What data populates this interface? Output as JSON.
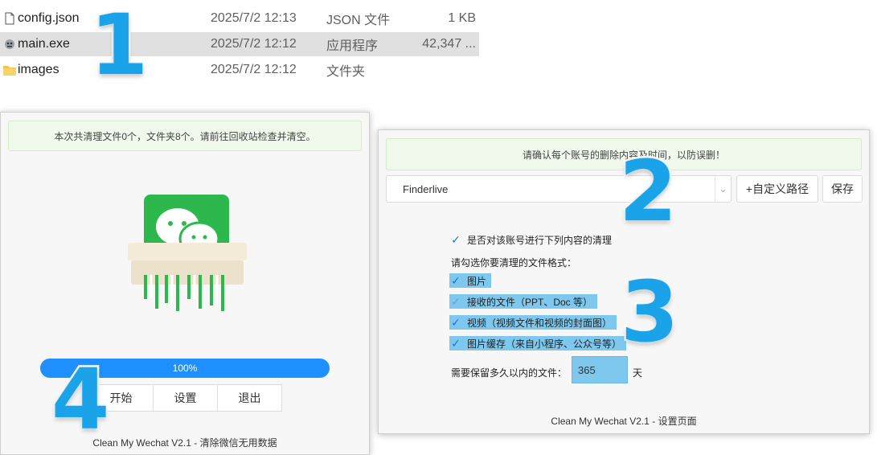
{
  "explorer": {
    "files": [
      {
        "icon": "json-file-icon",
        "name": "config.json",
        "date": "2025/7/2 12:13",
        "type": "JSON 文件",
        "size": "1 KB",
        "selected": false
      },
      {
        "icon": "exe-app-icon",
        "name": "main.exe",
        "date": "2025/7/2 12:12",
        "type": "应用程序",
        "size": "42,347 ...",
        "selected": true
      },
      {
        "icon": "folder-icon",
        "name": "images",
        "date": "2025/7/2 12:12",
        "type": "文件夹",
        "size": "",
        "selected": false
      }
    ]
  },
  "callouts": [
    "1",
    "2",
    "3",
    "4"
  ],
  "main_window": {
    "banner": "本次共清理文件0个，文件夹8个。请前往回收站检查并清空。",
    "logo_icon": "wechat-shredder-icon",
    "progress_label": "100%",
    "progress_value": 1.0,
    "buttons": {
      "start": "开始",
      "settings": "设置",
      "exit": "退出"
    },
    "footer": "Clean My Wechat V2.1 - 清除微信无用数据"
  },
  "settings_window": {
    "banner": "请确认每个账号的删除内容及时间，以防误删！",
    "account_select": {
      "value": "Finderlive"
    },
    "custom_path_button": "+自定义路径",
    "save_button": "保存",
    "enable_clean": {
      "label": "是否对该账号进行下列内容的清理",
      "checked": true
    },
    "format_prompt": "请勾选你要清理的文件格式：",
    "formats": [
      {
        "label": "图片",
        "checked": true
      },
      {
        "label": "接收的文件（PPT、Doc 等）",
        "checked": true
      },
      {
        "label": "视频（视频文件和视频的封面图）",
        "checked": true
      },
      {
        "label": "图片缓存（来自小程序、公众号等）",
        "checked": true
      }
    ],
    "retain_label": "需要保留多久以内的文件：",
    "retain_days": "365",
    "retain_unit": "天",
    "footer": "Clean My Wechat V2.1 - 设置页面"
  },
  "colors": {
    "accent": "#1e90ff",
    "highlight": "#7ec8ee",
    "callout": "#1aa3e8",
    "banner_bg": "#f0f9eb",
    "wechat_green": "#2db84d"
  }
}
